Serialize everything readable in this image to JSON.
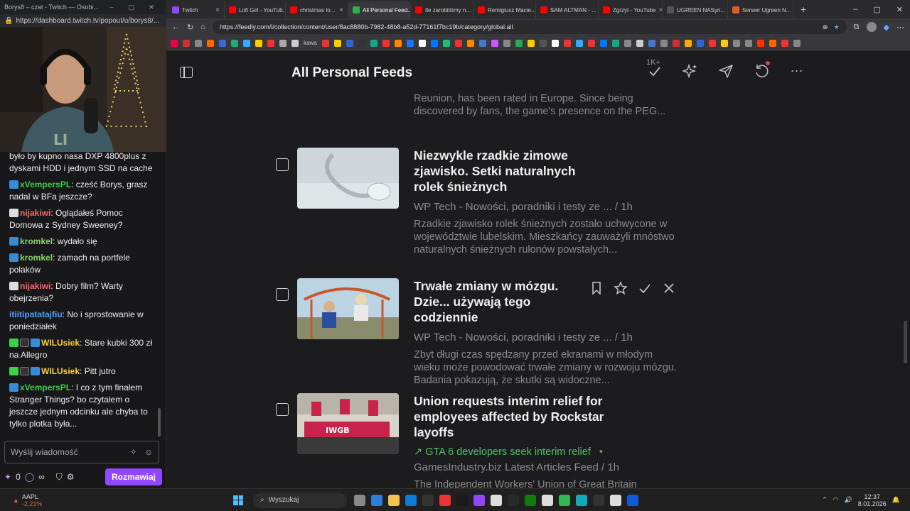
{
  "chat": {
    "window_title": "Borys8 – czat - Twitch — Osobi...",
    "url": "https://dashboard.twitch.tv/popout/u/borys8/...",
    "messages": [
      {
        "user": "",
        "user_color": "#efeff1",
        "text": "było by kupno nasa DXP 4800plus z dyskami HDD i jednym SSD na cache",
        "badges": []
      },
      {
        "user": "xVempersPL",
        "user_color": "#3ecf4c",
        "text": "cześć Borys, grasz nadal w BFa jeszcze?",
        "badges": [
          "sub"
        ]
      },
      {
        "user": "nijakiwi",
        "user_color": "#ff6a6a",
        "text": "Oglądałeś Pomoc Domowa z Sydney Sweeney?",
        "badges": [
          "dice"
        ]
      },
      {
        "user": "kromkel",
        "user_color": "#8bd36b",
        "text": "wydało się",
        "badges": [
          "sub"
        ]
      },
      {
        "user": "kromkel",
        "user_color": "#8bd36b",
        "text": "zamach na portfele polaków",
        "badges": [
          "sub"
        ]
      },
      {
        "user": "nijakiwi",
        "user_color": "#ff6a6a",
        "text": "Dobry film? Warty obejrzenia?",
        "badges": [
          "dice"
        ]
      },
      {
        "user": "itiitipatatajfiu",
        "user_color": "#4aa3ff",
        "text": "No i sprostowanie w poniedziałek",
        "badges": []
      },
      {
        "user": "WILUsiek",
        "user_color": "#ffcc33",
        "text": "Stare kubki 300 zł na Allegro",
        "badges": [
          "green",
          "rck",
          "sub"
        ]
      },
      {
        "user": "WILUsiek",
        "user_color": "#ffcc33",
        "text": "Pitt jutro",
        "badges": [
          "green",
          "rck",
          "sub"
        ]
      },
      {
        "user": "xVempersPL",
        "user_color": "#3ecf4c",
        "text": "I co z tym finałem Stranger Things? bo czytałem o jeszcze jednym odcinku ale chyba to tylko plotka była...",
        "badges": [
          "sub"
        ]
      }
    ],
    "input_placeholder": "Wyślij wiadomość",
    "points": "0",
    "infinity": "∞",
    "chat_button": "Rozmawiaj"
  },
  "browser": {
    "tabs": [
      {
        "label": "Twitch",
        "color": "#9147ff",
        "active": false
      },
      {
        "label": "Lofi Girl - YouTub...",
        "color": "#ff0000",
        "active": false
      },
      {
        "label": "christmas lo...",
        "color": "#ff0000",
        "active": false
      },
      {
        "label": "All Personal Feed...",
        "color": "#2bb24c",
        "active": true
      },
      {
        "label": "Ile zarobiliśmy n...",
        "color": "#ff0000",
        "active": false
      },
      {
        "label": "Remigiusz Macie...",
        "color": "#ff0000",
        "active": false
      },
      {
        "label": "SAM ALTMAN - ...",
        "color": "#ff0000",
        "active": false
      },
      {
        "label": "Zgrzyt - YouTube",
        "color": "#ff0000",
        "active": false
      },
      {
        "label": "UGREEN NASyn...",
        "color": "#555555",
        "active": false
      },
      {
        "label": "Serwer Ugreen N...",
        "color": "#e45a2a",
        "active": false
      }
    ],
    "url": "https://feedly.com/i/collection/content/user/8ac8880b-7982-48b8-a52d-77161f7bc19b/category/global.all",
    "bookmark_label": "kawa"
  },
  "feedly": {
    "page_title": "All Personal Feeds",
    "unread_count": "1K+",
    "articles": [
      {
        "title": "",
        "meta": "",
        "snippet": "Reunion, has been rated in Europe. Since being discovered by fans, the game's presence on the PEG...",
        "related": ""
      },
      {
        "title": "Niezwykle rzadkie zimowe zjawisko. Setki naturalnych rolek śnieżnych",
        "meta": "WP Tech - Nowości, poradniki i testy ze ... / 1h",
        "snippet": "Rzadkie zjawisko rolek śnieżnych zostało uchwycone w województwie lubelskim. Mieszkańcy zauważyli mnóstwo naturalnych śnieżnych rulonów powstałych...",
        "related": ""
      },
      {
        "title": "Trwałe zmiany w mózgu. Dzie... używają tego codziennie",
        "meta": "WP Tech - Nowości, poradniki i testy ze ... / 1h",
        "snippet": "Zbyt długi czas spędzany przed ekranami w młodym wieku może powodować trwałe zmiany w rozwoju mózgu. Badania pokazują, że skutki są widoczne...",
        "related": ""
      },
      {
        "title": "Union requests interim relief for employees affected by Rockstar layoffs",
        "meta": "GamesIndustry.biz Latest Articles Feed / 1h",
        "snippet": "The Independent Workers' Union of Great Britain",
        "related": "GTA 6 developers seek interim relief"
      }
    ]
  },
  "taskbar": {
    "stock_symbol": "AAPL",
    "stock_change": "-2,21%",
    "search_label": "Wyszukaj",
    "time": "12:37",
    "date": "8.01.2026"
  }
}
